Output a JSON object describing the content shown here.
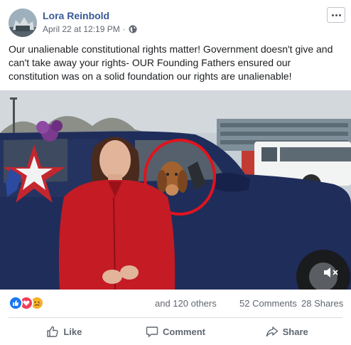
{
  "post": {
    "author": "Lora Reinbold",
    "timestamp": "April 22 at 12:19 PM",
    "separator": "·",
    "privacy_icon": "globe-icon",
    "text": "Our unalienable constitutional rights matter! Government doesn't give and can't take away your rights- OUR Founding Fathers ensured our constitution was on a solid foundation our rights are unalienable!"
  },
  "media": {
    "type": "video",
    "icon": "mute-icon"
  },
  "stats": {
    "reactions": [
      "like",
      "love",
      "sad"
    ],
    "others": "and 120 others",
    "comments": "52 Comments",
    "shares": "28 Shares"
  },
  "actions": {
    "like": "Like",
    "comment": "Comment",
    "share": "Share"
  },
  "colors": {
    "link": "#385898",
    "like": "#1877f2",
    "love": "#f33e58",
    "sad": "#f7b125",
    "muted": "#606770"
  }
}
